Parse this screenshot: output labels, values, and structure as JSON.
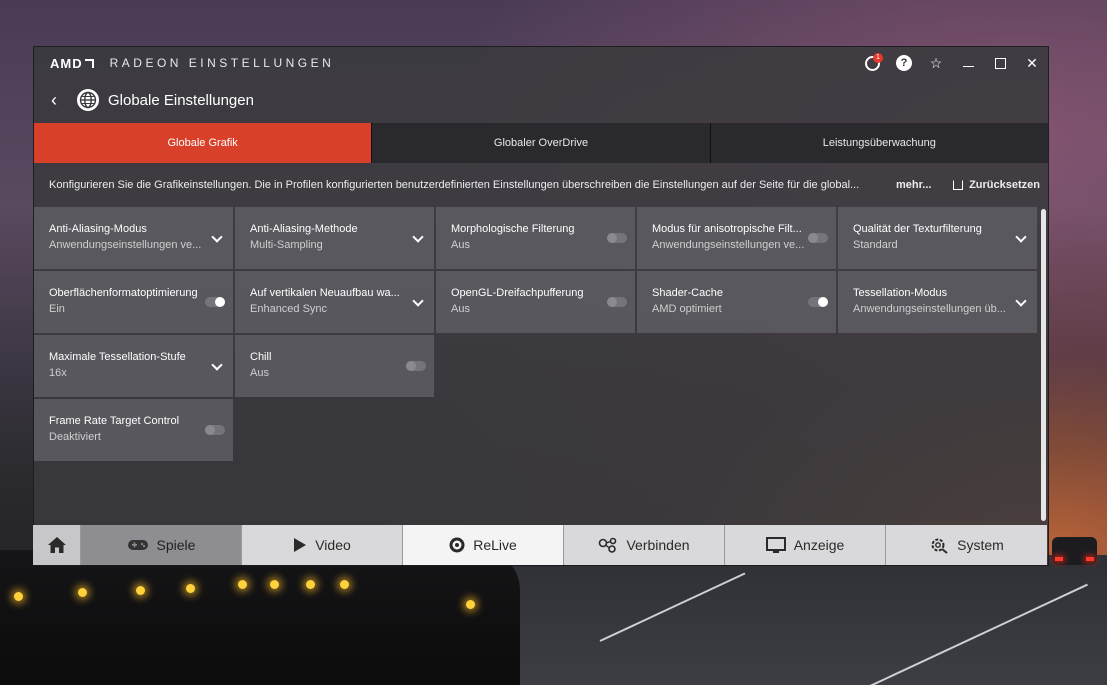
{
  "window": {
    "brand": "AMD",
    "app_title": "RADEON EINSTELLUNGEN",
    "notification_count": "1",
    "help_label": "?"
  },
  "header": {
    "title": "Globale Einstellungen"
  },
  "tabs": [
    {
      "label": "Globale Grafik",
      "active": true
    },
    {
      "label": "Globaler OverDrive",
      "active": false
    },
    {
      "label": "Leistungsüberwachung",
      "active": false
    }
  ],
  "info": {
    "text": "Konfigurieren Sie die Grafikeinstellungen. Die in Profilen konfigurierten benutzerdefinierten Einstellungen überschreiben die Einstellungen auf der Seite für die global...",
    "more": "mehr...",
    "reset": "Zurücksetzen"
  },
  "settings": [
    {
      "title": "Anti-Aliasing-Modus",
      "value": "Anwendungseinstellungen ve...",
      "control": "dropdown"
    },
    {
      "title": "Anti-Aliasing-Methode",
      "value": "Multi-Sampling",
      "control": "dropdown"
    },
    {
      "title": "Morphologische Filterung",
      "value": "Aus",
      "control": "toggle",
      "on": false
    },
    {
      "title": "Modus für anisotropische Filt...",
      "value": "Anwendungseinstellungen ve...",
      "control": "toggle",
      "on": false
    },
    {
      "title": "Qualität der Texturfilterung",
      "value": "Standard",
      "control": "dropdown"
    },
    {
      "title": "Oberflächenformatoptimierung",
      "value": "Ein",
      "control": "toggle",
      "on": true
    },
    {
      "title": "Auf vertikalen Neuaufbau wa...",
      "value": "Enhanced Sync",
      "control": "dropdown"
    },
    {
      "title": "OpenGL-Dreifachpufferung",
      "value": "Aus",
      "control": "toggle",
      "on": false
    },
    {
      "title": "Shader-Cache",
      "value": "AMD optimiert",
      "control": "toggle",
      "on": true
    },
    {
      "title": "Tessellation-Modus",
      "value": "Anwendungseinstellungen üb...",
      "control": "dropdown"
    },
    {
      "title": "Maximale Tessellation-Stufe",
      "value": "16x",
      "control": "dropdown"
    },
    {
      "title": "Chill",
      "value": "Aus",
      "control": "toggle",
      "on": false
    },
    {
      "title": "Frame Rate Target Control",
      "value": "Deaktiviert",
      "control": "toggle",
      "on": false
    }
  ],
  "bottom_nav": [
    {
      "label": "",
      "icon": "home-icon"
    },
    {
      "label": "Spiele",
      "icon": "gamepad-icon",
      "active": true
    },
    {
      "label": "Video",
      "icon": "play-icon"
    },
    {
      "label": "ReLive",
      "icon": "relive-icon"
    },
    {
      "label": "Verbinden",
      "icon": "connect-icon"
    },
    {
      "label": "Anzeige",
      "icon": "display-icon"
    },
    {
      "label": "System",
      "icon": "system-gear-icon"
    }
  ]
}
